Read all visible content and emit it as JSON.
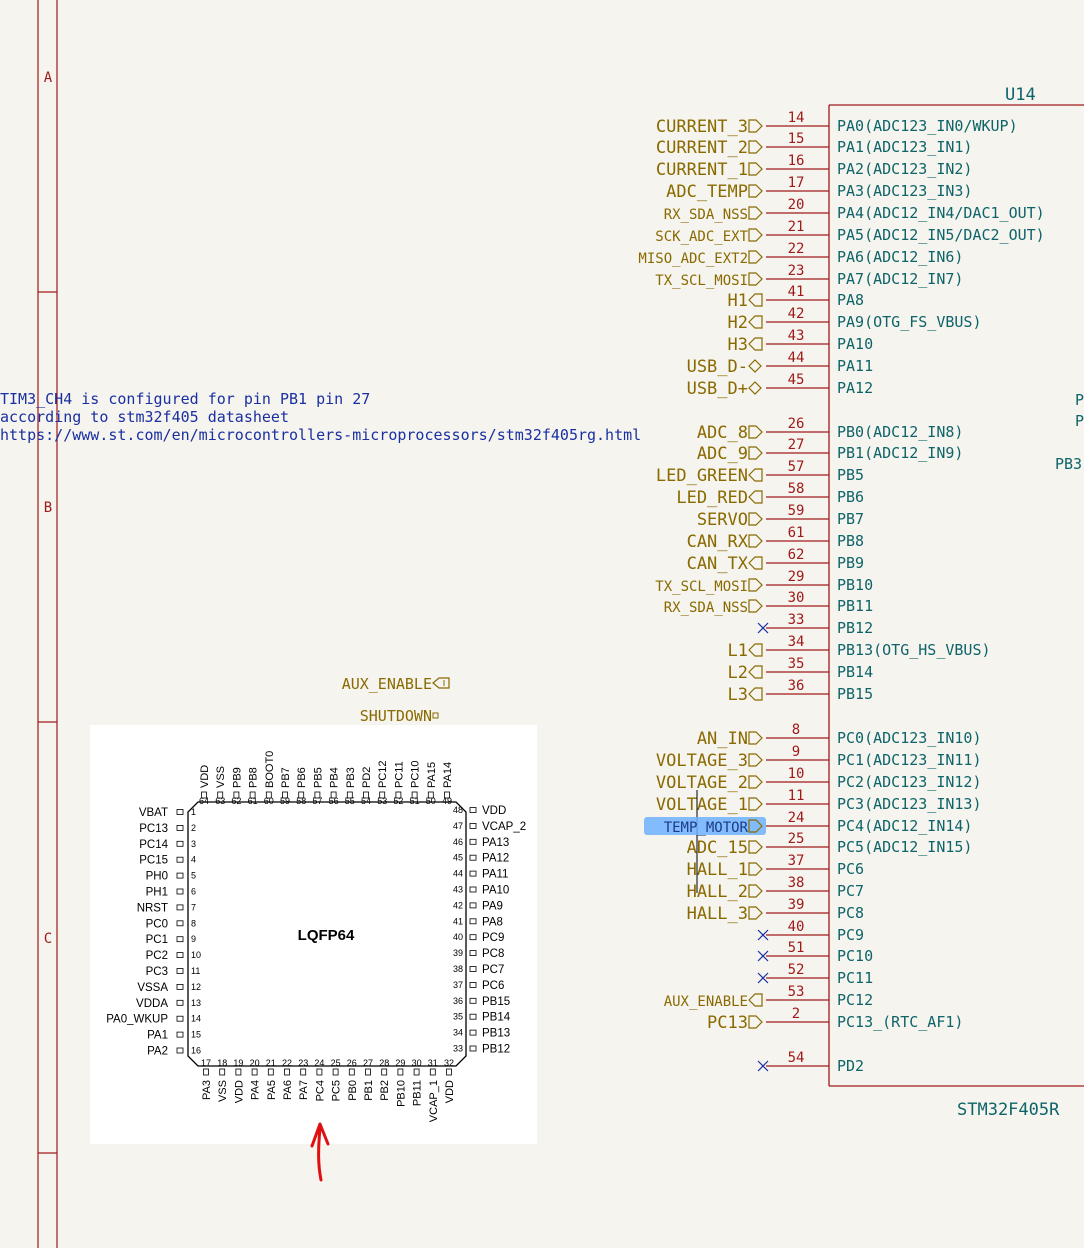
{
  "sheet": {
    "zones": [
      "A",
      "B",
      "C"
    ],
    "colors": {
      "border": "#a11a1a",
      "net": "#8a6a00",
      "pin_name": "#0e6469",
      "pin_number": "#a11a1a",
      "note": "#1a2fa0",
      "highlight": "#6fb1ff"
    }
  },
  "note": {
    "lines": [
      "TIM3_CH4 is configured for pin PB1 pin 27",
      "according to stm32f405 datasheet",
      "https://www.st.com/en/microcontrollers-microprocessors/stm32f405rg.html"
    ]
  },
  "loose_labels": [
    {
      "text": "AUX_ENABLE",
      "shape": "input"
    },
    {
      "text": "SHUTDOWN",
      "shape": "passive"
    }
  ],
  "symbol": {
    "ref": "U14",
    "value": "STM32F405R",
    "right_edge_fragments": [
      "P",
      "P",
      "PB3"
    ],
    "pins": [
      {
        "net": "CURRENT_3",
        "shape": "output",
        "num": "14",
        "name": "PA0(ADC123_IN0/WKUP)"
      },
      {
        "net": "CURRENT_2",
        "shape": "output",
        "num": "15",
        "name": "PA1(ADC123_IN1)"
      },
      {
        "net": "CURRENT_1",
        "shape": "output",
        "num": "16",
        "name": "PA2(ADC123_IN2)"
      },
      {
        "net": "ADC_TEMP",
        "shape": "output",
        "num": "17",
        "name": "PA3(ADC123_IN3)"
      },
      {
        "net": "RX_SDA_NSS",
        "shape": "output",
        "num": "20",
        "name": "PA4(ADC12_IN4/DAC1_OUT)"
      },
      {
        "net": "SCK_ADC_EXT",
        "shape": "output",
        "num": "21",
        "name": "PA5(ADC12_IN5/DAC2_OUT)"
      },
      {
        "net": "MISO_ADC_EXT2",
        "shape": "output",
        "num": "22",
        "name": "PA6(ADC12_IN6)"
      },
      {
        "net": "TX_SCL_MOSI",
        "shape": "output",
        "num": "23",
        "name": "PA7(ADC12_IN7)"
      },
      {
        "net": "H1",
        "shape": "input",
        "num": "41",
        "name": "PA8"
      },
      {
        "net": "H2",
        "shape": "input",
        "num": "42",
        "name": "PA9(OTG_FS_VBUS)"
      },
      {
        "net": "H3",
        "shape": "input",
        "num": "43",
        "name": "PA10"
      },
      {
        "net": "USB_D-",
        "shape": "bidir",
        "num": "44",
        "name": "PA11"
      },
      {
        "net": "USB_D+",
        "shape": "bidir",
        "num": "45",
        "name": "PA12"
      },
      {
        "net": "ADC_8",
        "shape": "output",
        "num": "26",
        "name": "PB0(ADC12_IN8)"
      },
      {
        "net": "ADC_9",
        "shape": "output",
        "num": "27",
        "name": "PB1(ADC12_IN9)"
      },
      {
        "net": "LED_GREEN",
        "shape": "input",
        "num": "57",
        "name": "PB5"
      },
      {
        "net": "LED_RED",
        "shape": "input",
        "num": "58",
        "name": "PB6"
      },
      {
        "net": "SERVO",
        "shape": "output",
        "num": "59",
        "name": "PB7"
      },
      {
        "net": "CAN_RX",
        "shape": "output",
        "num": "61",
        "name": "PB8"
      },
      {
        "net": "CAN_TX",
        "shape": "input",
        "num": "62",
        "name": "PB9"
      },
      {
        "net": "TX_SCL_MOSI",
        "shape": "output",
        "num": "29",
        "name": "PB10"
      },
      {
        "net": "RX_SDA_NSS",
        "shape": "output",
        "num": "30",
        "name": "PB11"
      },
      {
        "net": "",
        "shape": "nc",
        "num": "33",
        "name": "PB12"
      },
      {
        "net": "L1",
        "shape": "input",
        "num": "34",
        "name": "PB13(OTG_HS_VBUS)"
      },
      {
        "net": "L2",
        "shape": "input",
        "num": "35",
        "name": "PB14"
      },
      {
        "net": "L3",
        "shape": "input",
        "num": "36",
        "name": "PB15"
      },
      {
        "net": "AN_IN",
        "shape": "output",
        "num": "8",
        "name": "PC0(ADC123_IN10)"
      },
      {
        "net": "VOLTAGE_3",
        "shape": "output",
        "num": "9",
        "name": "PC1(ADC123_IN11)"
      },
      {
        "net": "VOLTAGE_2",
        "shape": "output",
        "num": "10",
        "name": "PC2(ADC123_IN12)"
      },
      {
        "net": "VOLTAGE_1",
        "shape": "output",
        "num": "11",
        "name": "PC3(ADC123_IN13)"
      },
      {
        "net": "TEMP_MOTOR",
        "shape": "output",
        "num": "24",
        "name": "PC4(ADC12_IN14)",
        "highlight": true
      },
      {
        "net": "ADC_15",
        "shape": "output",
        "num": "25",
        "name": "PC5(ADC12_IN15)"
      },
      {
        "net": "HALL_1",
        "shape": "output",
        "num": "37",
        "name": "PC6"
      },
      {
        "net": "HALL_2",
        "shape": "output",
        "num": "38",
        "name": "PC7"
      },
      {
        "net": "HALL_3",
        "shape": "output",
        "num": "39",
        "name": "PC8"
      },
      {
        "net": "",
        "shape": "nc",
        "num": "40",
        "name": "PC9"
      },
      {
        "net": "",
        "shape": "nc",
        "num": "51",
        "name": "PC10"
      },
      {
        "net": "",
        "shape": "nc",
        "num": "52",
        "name": "PC11"
      },
      {
        "net": "AUX_ENABLE",
        "shape": "input",
        "num": "53",
        "name": "PC12"
      },
      {
        "net": "PC13",
        "shape": "output",
        "num": "2",
        "name": "PC13_(RTC_AF1)"
      },
      {
        "net": "",
        "shape": "nc",
        "num": "54",
        "name": "PD2"
      }
    ]
  },
  "lqfp": {
    "package_label": "LQFP64",
    "top_names": [
      "VDD",
      "VSS",
      "PB9",
      "PB8",
      "BOOT0",
      "PB7",
      "PB6",
      "PB5",
      "PB4",
      "PB3",
      "PD2",
      "PC12",
      "PC11",
      "PC10",
      "PA15",
      "PA14"
    ],
    "top_nums": [
      "64",
      "63",
      "62",
      "61",
      "60",
      "59",
      "58",
      "57",
      "56",
      "55",
      "54",
      "53",
      "52",
      "51",
      "50",
      "49"
    ],
    "left_names": [
      "VBAT",
      "PC13",
      "PC14",
      "PC15",
      "PH0",
      "PH1",
      "NRST",
      "PC0",
      "PC1",
      "PC2",
      "PC3",
      "VSSA",
      "VDDA",
      "PA0_WKUP",
      "PA1",
      "PA2"
    ],
    "left_nums": [
      "1",
      "2",
      "3",
      "4",
      "5",
      "6",
      "7",
      "8",
      "9",
      "10",
      "11",
      "12",
      "13",
      "14",
      "15",
      "16"
    ],
    "right_names": [
      "VDD",
      "VCAP_2",
      "PA13",
      "PA12",
      "PA11",
      "PA10",
      "PA9",
      "PA8",
      "PC9",
      "PC8",
      "PC7",
      "PC6",
      "PB15",
      "PB14",
      "PB13",
      "PB12"
    ],
    "right_nums": [
      "48",
      "47",
      "46",
      "45",
      "44",
      "43",
      "42",
      "41",
      "40",
      "39",
      "38",
      "37",
      "36",
      "35",
      "34",
      "33"
    ],
    "bottom_names": [
      "PA3",
      "VSS",
      "VDD",
      "PA4",
      "PA5",
      "PA6",
      "PA7",
      "PC4",
      "PC5",
      "PB0",
      "PB1",
      "PB2",
      "PB10",
      "PB11",
      "VCAP_1",
      "VDD"
    ],
    "bottom_nums": [
      "17",
      "18",
      "19",
      "20",
      "21",
      "22",
      "23",
      "24",
      "25",
      "26",
      "27",
      "28",
      "29",
      "30",
      "31",
      "32"
    ]
  }
}
